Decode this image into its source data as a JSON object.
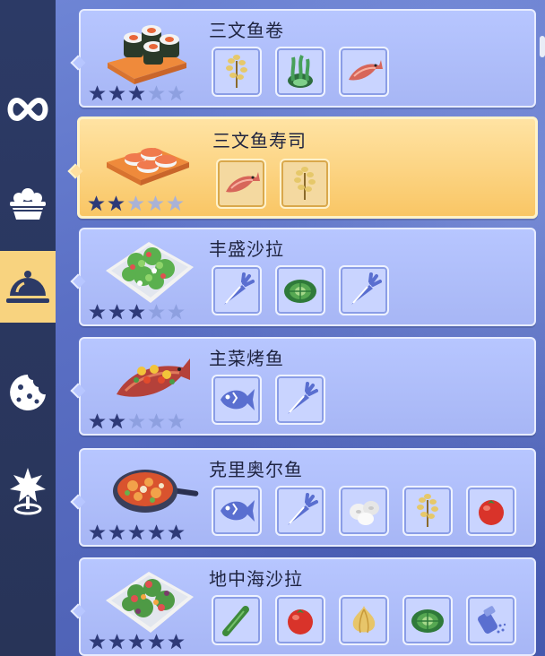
{
  "colors": {
    "sidebar_bg": "#2c3a66",
    "sidebar_active": "#f8d37f",
    "card_bg": "#b7c6ff",
    "card_selected": "#f9c665",
    "star_filled": "#2e3a78",
    "star_empty": "#8ea0e0",
    "blue_icon": "#5a6fd0"
  },
  "sidebar": {
    "items": [
      {
        "icon": "infinity-icon",
        "active": false
      },
      {
        "icon": "bowl-icon",
        "active": false
      },
      {
        "icon": "cloche-icon",
        "active": true
      },
      {
        "icon": "cookie-icon",
        "active": false
      },
      {
        "icon": "location-burst-icon",
        "active": false
      }
    ]
  },
  "recipes": [
    {
      "name": "三文鱼卷",
      "stars": 3,
      "selected": false,
      "dish": "salmon-roll-icon",
      "ingredients": [
        "rice-grain-icon",
        "seaweed-icon",
        "salmon-icon"
      ]
    },
    {
      "name": "三文鱼寿司",
      "stars": 2,
      "selected": true,
      "dish": "salmon-sushi-icon",
      "ingredients": [
        "salmon-icon",
        "rice-grain-icon"
      ]
    },
    {
      "name": "丰盛沙拉",
      "stars": 3,
      "selected": false,
      "dish": "hearty-salad-icon",
      "ingredients": [
        "carrot-icon",
        "lettuce-icon",
        "carrot-icon"
      ]
    },
    {
      "name": "主菜烤鱼",
      "stars": 2,
      "selected": false,
      "dish": "grilled-fish-icon",
      "ingredients": [
        "fish-icon",
        "carrot-icon"
      ]
    },
    {
      "name": "克里奥尔鱼",
      "stars": 5,
      "selected": false,
      "dish": "creole-fish-icon",
      "ingredients": [
        "fish-icon",
        "carrot-icon",
        "mushroom-icon",
        "rice-grain-icon",
        "tomato-icon"
      ]
    },
    {
      "name": "地中海沙拉",
      "stars": 5,
      "selected": false,
      "dish": "mediterranean-salad-icon",
      "ingredients": [
        "cucumber-icon",
        "tomato-icon",
        "onion-icon",
        "lettuce-icon",
        "salt-shaker-icon"
      ]
    }
  ]
}
